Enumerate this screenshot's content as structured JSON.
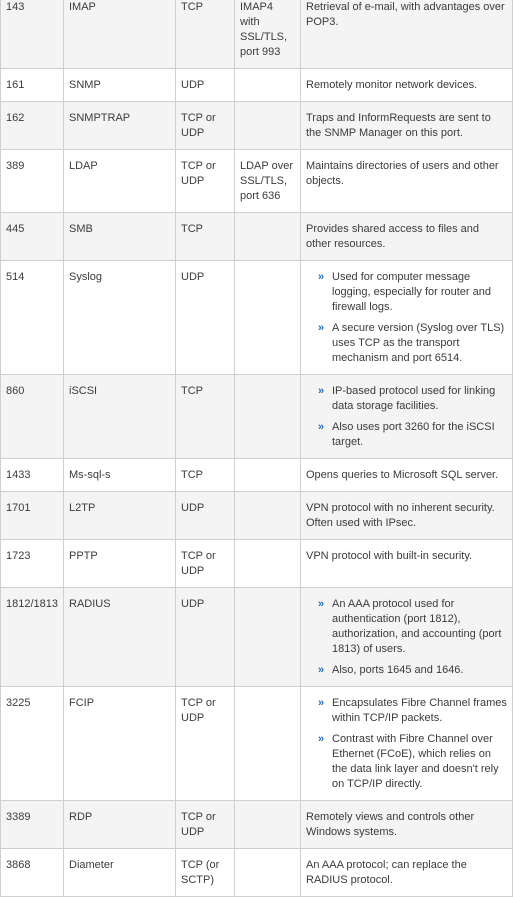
{
  "rows": [
    {
      "port": "143",
      "name": "IMAP",
      "proto": "TCP",
      "secure": "IMAP4 with SSL/TLS, port 993",
      "desc": "Retrieval of e-mail, with advantages over POP3."
    },
    {
      "port": "161",
      "name": "SNMP",
      "proto": "UDP",
      "secure": "",
      "desc": "Remotely monitor network devices."
    },
    {
      "port": "162",
      "name": "SNMPTRAP",
      "proto": "TCP or UDP",
      "secure": "",
      "desc": "Traps and InformRequests are sent to the SNMP Manager on this port."
    },
    {
      "port": "389",
      "name": "LDAP",
      "proto": "TCP or UDP",
      "secure": "LDAP over SSL/TLS, port 636",
      "desc": "Maintains directories of users and other objects."
    },
    {
      "port": "445",
      "name": "SMB",
      "proto": "TCP",
      "secure": "",
      "desc": "Provides shared access to files and other resources."
    },
    {
      "port": "514",
      "name": "Syslog",
      "proto": "UDP",
      "secure": "",
      "bullets": [
        "Used for computer message logging, especially for router and firewall logs.",
        "A secure version (Syslog over TLS) uses TCP as the transport mechanism and port 6514."
      ]
    },
    {
      "port": "860",
      "name": "iSCSI",
      "proto": "TCP",
      "secure": "",
      "bullets": [
        "IP-based protocol used for linking data storage facilities.",
        "Also uses port 3260 for the iSCSI target."
      ]
    },
    {
      "port": "1433",
      "name": "Ms-sql-s",
      "proto": "TCP",
      "secure": "",
      "desc": "Opens queries to Microsoft SQL server."
    },
    {
      "port": "1701",
      "name": "L2TP",
      "proto": "UDP",
      "secure": "",
      "desc": "VPN protocol with no inherent security. Often used with IPsec."
    },
    {
      "port": "1723",
      "name": "PPTP",
      "proto": "TCP or UDP",
      "secure": "",
      "desc": "VPN protocol with built-in security."
    },
    {
      "port": "1812/1813",
      "name": "RADIUS",
      "proto": "UDP",
      "secure": "",
      "bullets": [
        "An AAA protocol used for authentication (port 1812), authorization, and accounting (port 1813) of users.",
        "Also, ports 1645 and 1646."
      ]
    },
    {
      "port": "3225",
      "name": "FCIP",
      "proto": "TCP or UDP",
      "secure": "",
      "bullets": [
        "Encapsulates Fibre Channel frames within TCP/IP packets.",
        "Contrast with Fibre Channel over Ethernet (FCoE), which relies on the data link layer and doesn't rely on TCP/IP directly."
      ]
    },
    {
      "port": "3389",
      "name": "RDP",
      "proto": "TCP or UDP",
      "secure": "",
      "desc": "Remotely views and controls other Windows systems."
    },
    {
      "port": "3868",
      "name": "Diameter",
      "proto": "TCP (or SCTP)",
      "secure": "",
      "desc": "An AAA protocol; can replace the RADIUS protocol."
    }
  ],
  "bullet_marker": "»",
  "colors": {
    "bullet": "#1f6fbf",
    "border": "#cfcfcf",
    "row_shade": "#f4f4f4"
  }
}
